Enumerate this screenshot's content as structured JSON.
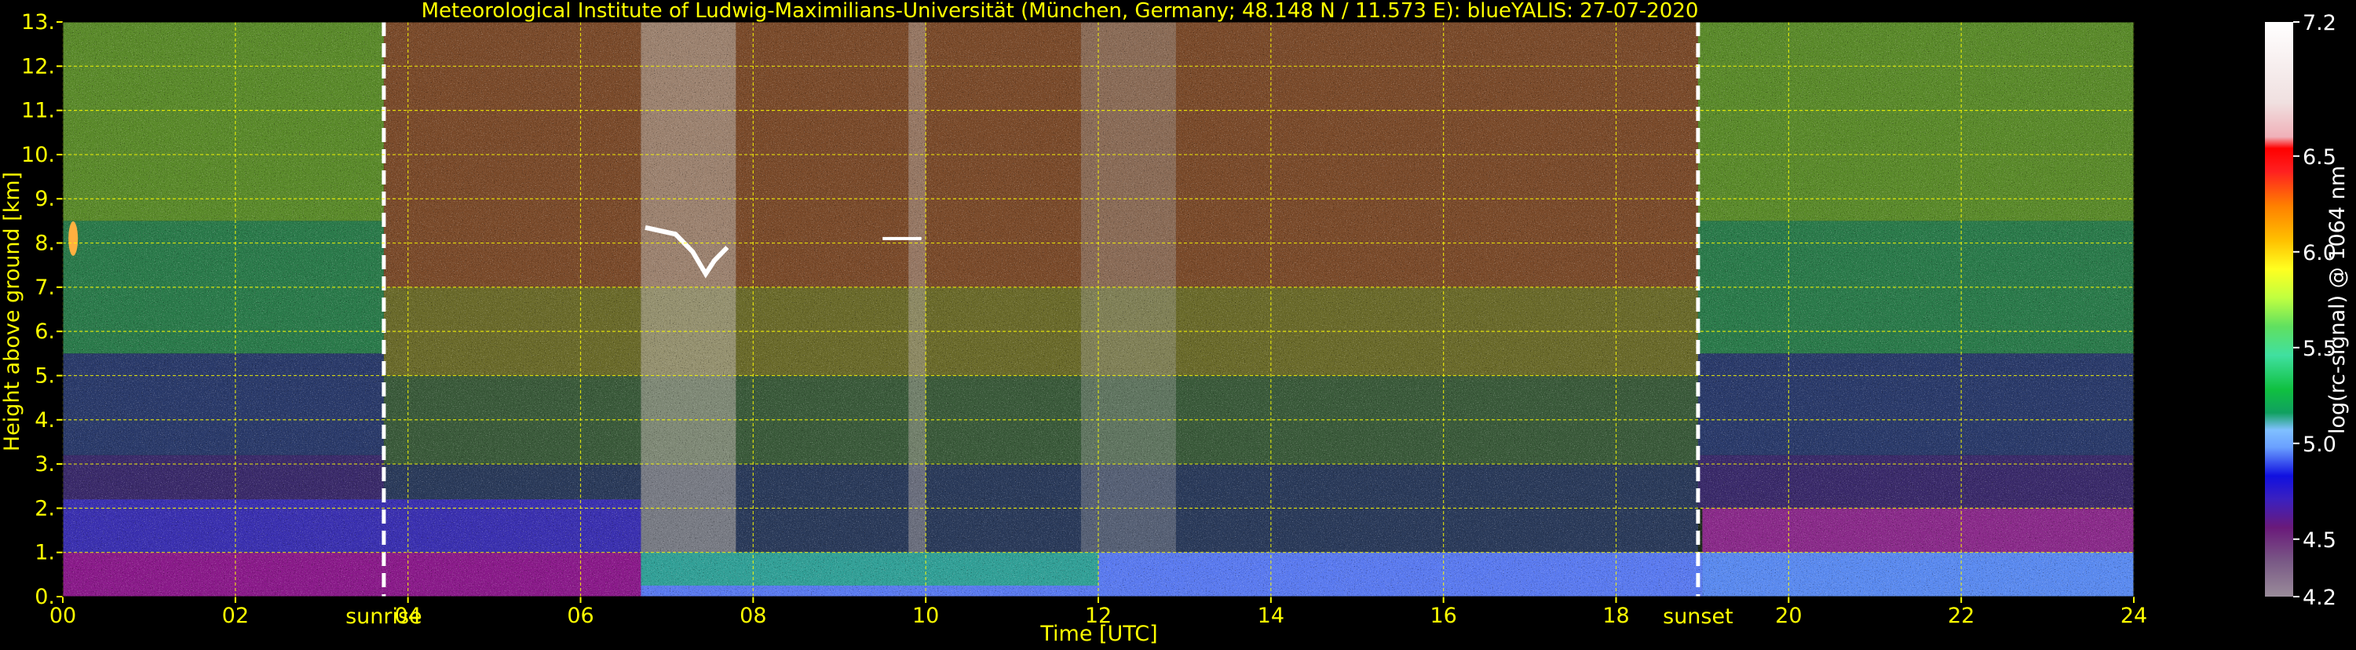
{
  "chart_data": {
    "type": "heatmap",
    "title": "Meteorological Institute of Ludwig-Maximilians-Universität (München, Germany; 48.148 N / 11.573 E):    blueYALIS: 27-07-2020",
    "xlabel": "Time [UTC]",
    "ylabel": "Height above ground [km]",
    "xlim": [
      0,
      24
    ],
    "ylim": [
      0,
      13
    ],
    "x_ticks": [
      "00",
      "02",
      "04",
      "06",
      "08",
      "10",
      "12",
      "14",
      "16",
      "18",
      "20",
      "22",
      "24"
    ],
    "y_ticks": [
      "0.",
      "1.",
      "2.",
      "3.",
      "4.",
      "5.",
      "6.",
      "7.",
      "8.",
      "9.",
      "10.",
      "11.",
      "12.",
      "13."
    ],
    "grid": true,
    "markers": [
      {
        "label": "sunrise",
        "time": 3.72
      },
      {
        "label": "sunset",
        "time": 18.95
      }
    ],
    "colorbar": {
      "label": "log(rc-signal) @ 1064 nm",
      "range": [
        4.2,
        7.2
      ],
      "ticks": [
        "4.2",
        "4.5",
        "5.0",
        "5.5",
        "6.0",
        "6.5",
        "7.2"
      ],
      "tick_values": [
        4.2,
        4.5,
        5.0,
        5.5,
        6.0,
        6.5,
        7.2
      ]
    },
    "colors": {
      "text": "#ffff00",
      "grid": "#ffff00",
      "background": "#000000",
      "marker_line": "#ffffff"
    }
  }
}
